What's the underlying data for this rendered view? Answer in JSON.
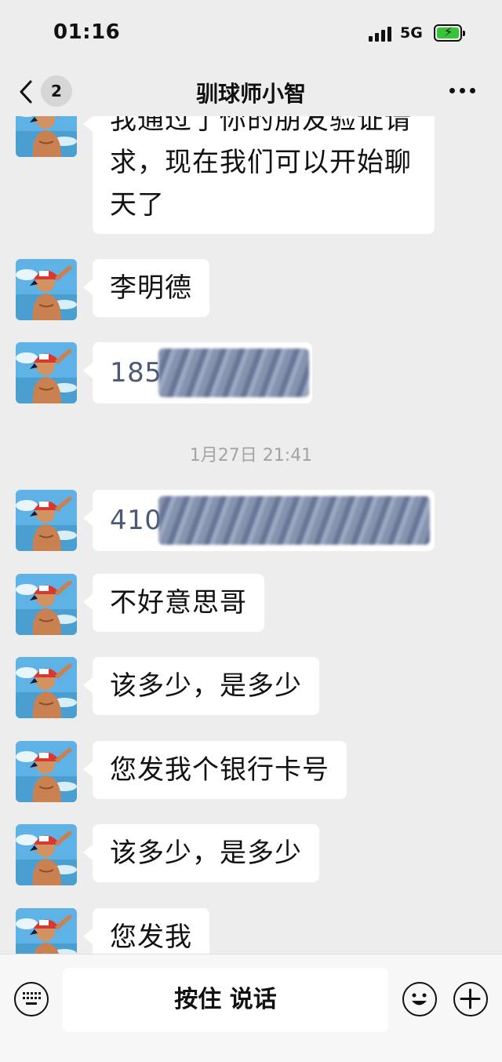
{
  "status_bar": {
    "time": "01:16",
    "network": "5G",
    "battery_level": 1.0,
    "battery_charging": true,
    "battery_color": "#38c437"
  },
  "nav": {
    "back_icon": "chevron-left-icon",
    "unread_count": "2",
    "title": "驯球师小智",
    "more_icon": "ellipsis-icon"
  },
  "messages": [
    {
      "type": "text",
      "text_lines": [
        "我通过了你的朋友验证请",
        "求，现在我们可以开始聊",
        "天了"
      ]
    },
    {
      "type": "text",
      "text": "李明德"
    },
    {
      "type": "redacted",
      "visible_prefix": "185"
    },
    {
      "type": "timestamp",
      "text": "1月27日 21:41"
    },
    {
      "type": "redacted",
      "visible_prefix": "410"
    },
    {
      "type": "text",
      "text": "不好意思哥"
    },
    {
      "type": "text",
      "text": "该多少，是多少"
    },
    {
      "type": "text",
      "text": "您发我个银行卡号"
    },
    {
      "type": "text",
      "text": "该多少，是多少"
    },
    {
      "type": "text",
      "text": "您发我"
    }
  ],
  "input_bar": {
    "keyboard_icon": "keyboard-icon",
    "hold_to_talk_label": "按住 说话",
    "emoji_icon": "emoji-icon",
    "plus_icon": "plus-icon"
  },
  "colors": {
    "background": "#ededed",
    "bubble": "#ffffff",
    "timestamp": "#a3a3a3",
    "number_text": "#4a5a78"
  }
}
